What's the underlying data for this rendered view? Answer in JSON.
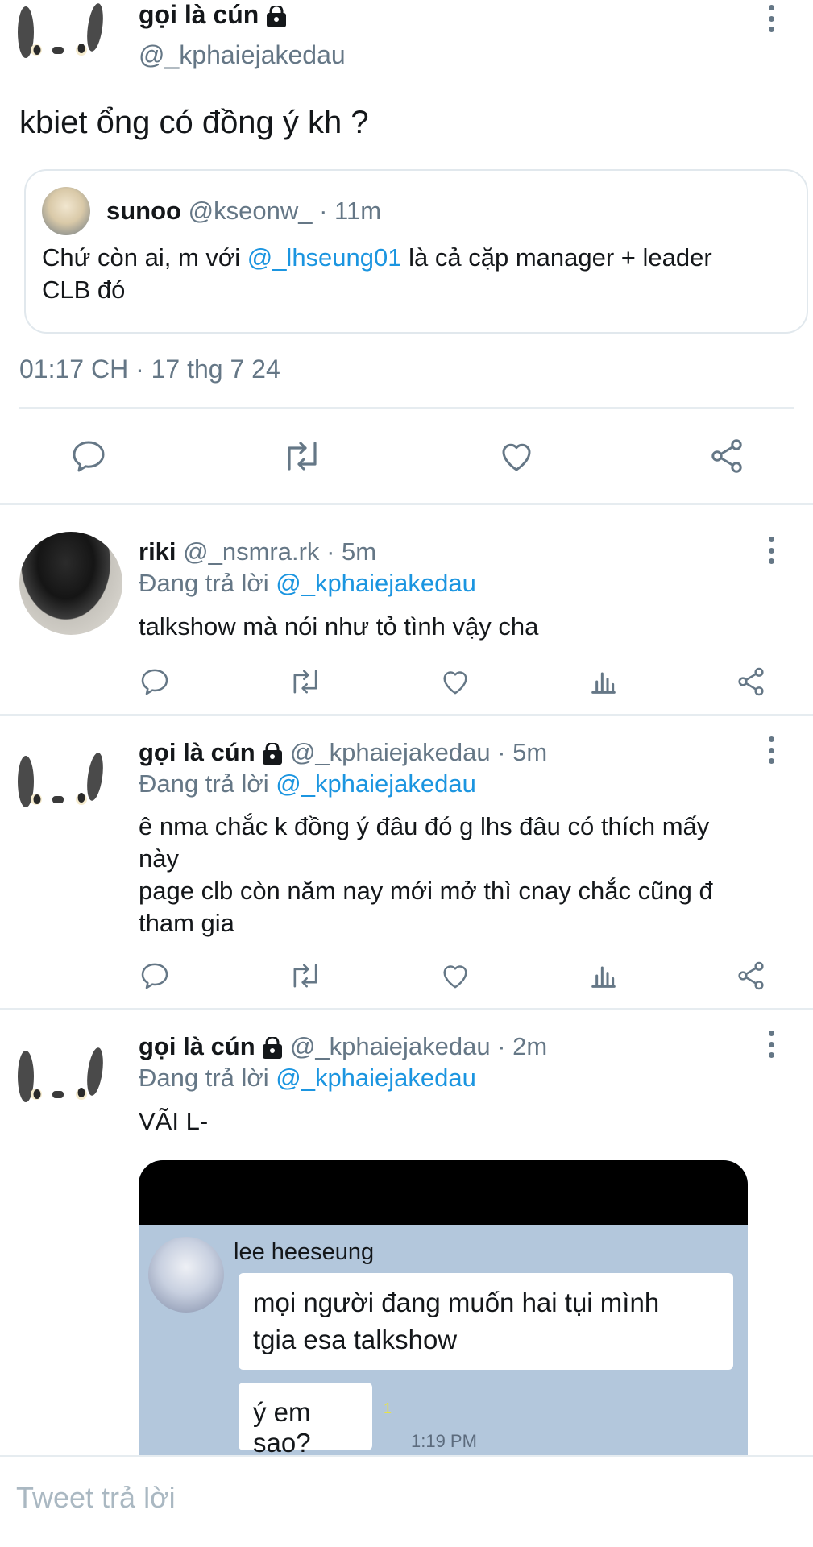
{
  "main_tweet": {
    "display_name": "gọi là cún",
    "handle": "@_kphaiejakedau",
    "text": "kbiet ổng có đồng ý kh ?",
    "quote": {
      "name": "sunoo",
      "handle": "@kseonw_",
      "time": "· 11m",
      "text_before": "Chứ còn ai, m với ",
      "mention": "@_lhseung01",
      "text_after": " là cả cặp manager + leader CLB đó"
    },
    "timestamp": "01:17 CH · 17 thg 7 24"
  },
  "replies": [
    {
      "name": "riki",
      "handle": "@_nsmra.rk",
      "time": "· 5m",
      "replying_prefix": "Đang trả lời ",
      "replying_to": "@_kphaiejakedau",
      "text": "talkshow mà nói như tỏ tình vậy cha"
    },
    {
      "name": "gọi là cún",
      "handle": "@_kphaiejakedau",
      "time": "· 5m",
      "replying_prefix": "Đang trả lời ",
      "replying_to": "@_kphaiejakedau",
      "text_line1": "ê nma chắc k đồng ý đâu đó g lhs đâu có thích mấy",
      "text_line2": "này",
      "text_line3": "page clb còn năm nay mới mở thì cnay chắc cũng đ",
      "text_line4": "tham gia"
    },
    {
      "name": "gọi là cún",
      "handle": "@_kphaiejakedau",
      "time": "· 2m",
      "replying_prefix": "Đang trả lời ",
      "replying_to": "@_kphaiejakedau",
      "text": "VÃI L-"
    }
  ],
  "chat_screenshot": {
    "sender": "lee heeseung",
    "bubble1_line1": "mọi người đang muốn hai tụi mình",
    "bubble1_line2": "tgia esa talkshow",
    "bubble2": "ý em sao?",
    "read_count": "1",
    "time": "1:19 PM"
  },
  "compose": {
    "placeholder": "Tweet trả lời"
  },
  "icons": [
    "reply-icon",
    "retweet-icon",
    "like-icon",
    "analytics-icon",
    "share-icon",
    "more-icon",
    "lock-icon"
  ],
  "colors": {
    "link": "#1b95e0",
    "secondary_text": "#657786",
    "chat_background": "#b3c7dc"
  }
}
